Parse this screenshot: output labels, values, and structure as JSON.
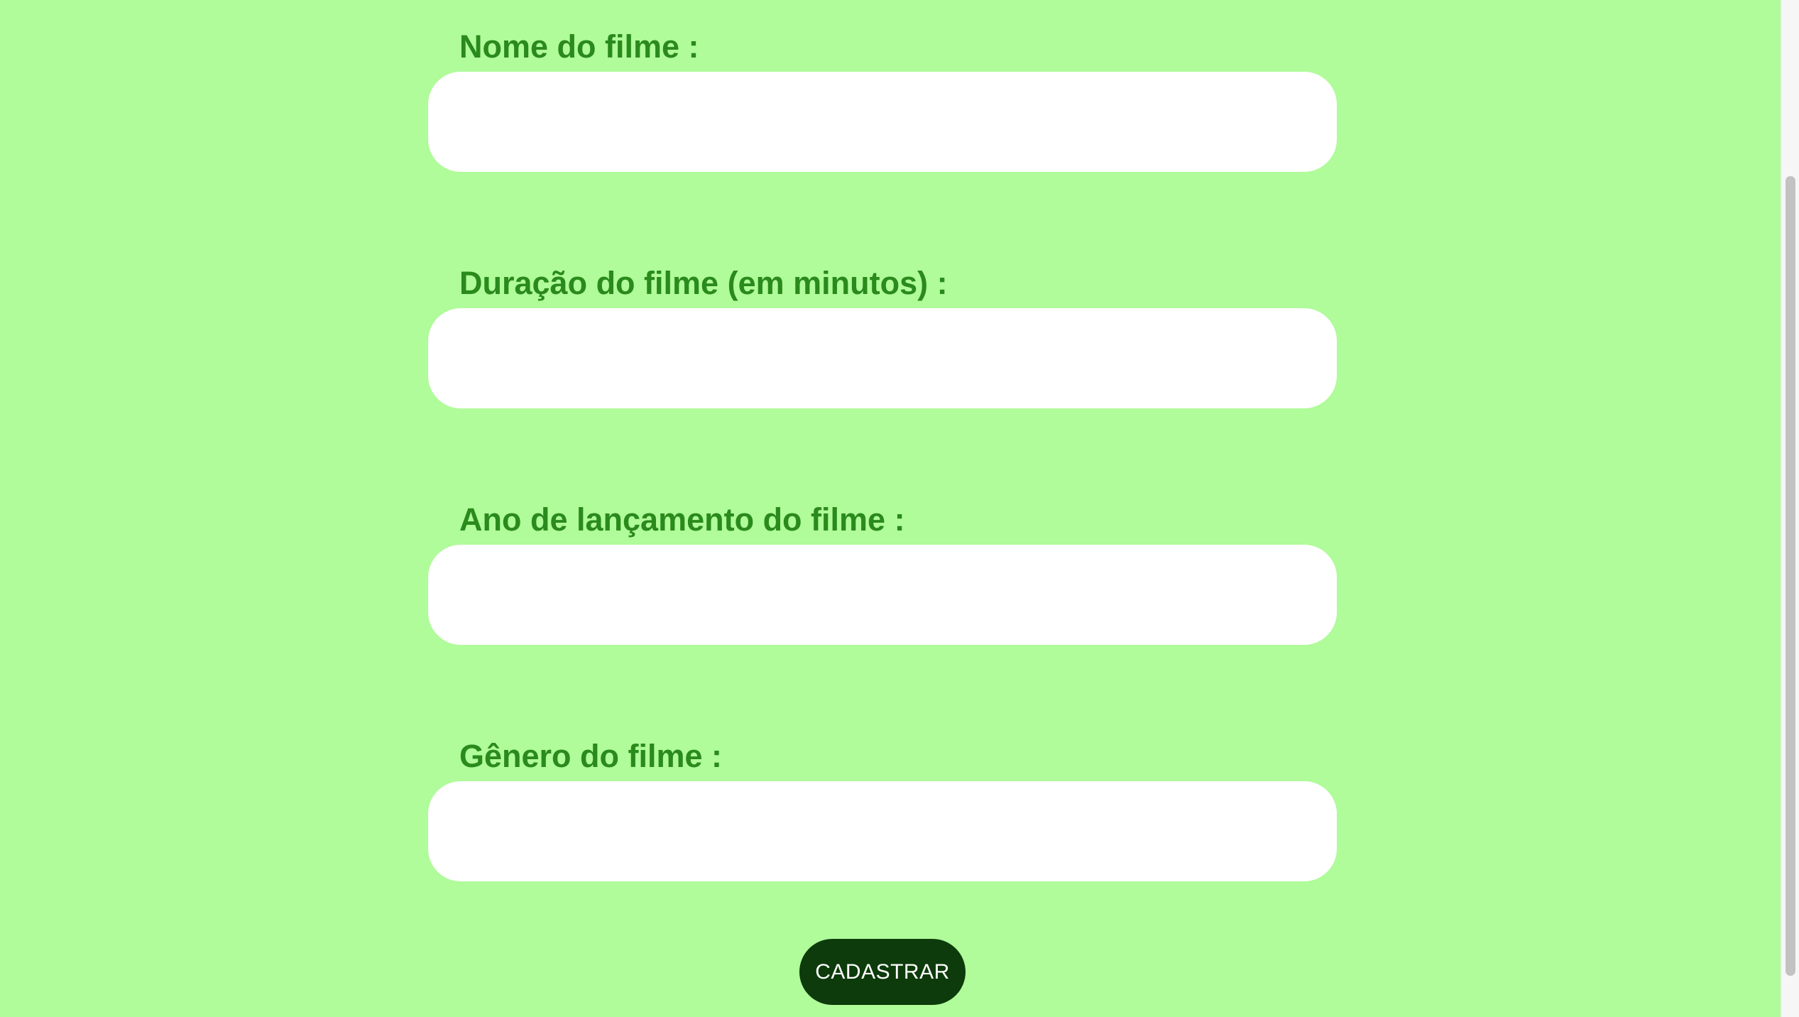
{
  "form": {
    "fields": [
      {
        "label": "Nome do filme :",
        "value": "",
        "placeholder": ""
      },
      {
        "label": "Duração do filme (em minutos) :",
        "value": "",
        "placeholder": ""
      },
      {
        "label": "Ano de lançamento do filme :",
        "value": "",
        "placeholder": ""
      },
      {
        "label": "Gênero do filme :",
        "value": "",
        "placeholder": ""
      }
    ],
    "submit_label": "CADASTRAR"
  },
  "colors": {
    "background": "#b0fb9a",
    "label": "#2a8a1c",
    "input_background": "#ffffff",
    "button_background": "#0d3b0b",
    "button_text": "#ffffff"
  }
}
